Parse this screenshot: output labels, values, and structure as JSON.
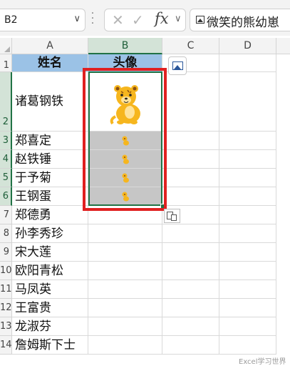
{
  "formula_bar": {
    "name_box": "B2",
    "fx_label": "fx",
    "content": "微笑的熊幼崽"
  },
  "columns": [
    "A",
    "B",
    "C",
    "D"
  ],
  "rows": [
    "1",
    "2",
    "3",
    "4",
    "5",
    "6",
    "7",
    "8",
    "9",
    "10",
    "11",
    "12",
    "13",
    "14"
  ],
  "table": {
    "header_name": "姓名",
    "header_avatar": "头像",
    "names": [
      "诸葛钢铁",
      "郑喜定",
      "赵铁锤",
      "于予菊",
      "王钢蛋",
      "郑德勇",
      "孙李秀珍",
      "宋大莲",
      "欧阳青松",
      "马凤英",
      "王富贵",
      "龙淑芬",
      "詹姆斯下士"
    ]
  },
  "selected_cell": "B2",
  "selection_range": "B2:B6",
  "watermark": "Excel学习世界",
  "colors": {
    "header_fill": "#9bc2e6",
    "selection_green": "#217346",
    "highlight_red": "#e02020",
    "cub_yellow": "#f6b61e"
  },
  "icons": [
    "cancel-icon",
    "enter-icon",
    "fx-icon",
    "image-icon",
    "paste-options-icon",
    "cub-image"
  ]
}
